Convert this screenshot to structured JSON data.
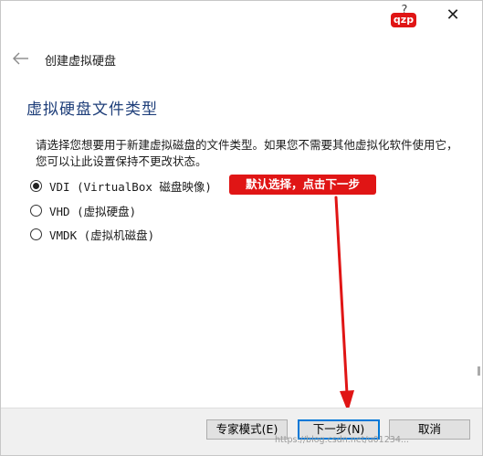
{
  "window": {
    "help_glyph": "?",
    "close_glyph": "✕",
    "stamp_text": "qzp"
  },
  "header": {
    "back_arrow": "←",
    "title": "创建虚拟硬盘"
  },
  "page": {
    "section_title": "虚拟硬盘文件类型",
    "description": "请选择您想要用于新建虚拟磁盘的文件类型。如果您不需要其他虚拟化软件使用它，您可以让此设置保持不更改状态。",
    "options": [
      {
        "label": "VDI (VirtualBox 磁盘映像)",
        "checked": true
      },
      {
        "label": "VHD (虚拟硬盘)",
        "checked": false
      },
      {
        "label": "VMDK (虚拟机磁盘)",
        "checked": false
      }
    ]
  },
  "annotation": {
    "note": "默认选择，点击下一步",
    "color": "#e01515"
  },
  "footer": {
    "expert_label": "专家模式(E)",
    "next_label": "下一步(N)",
    "cancel_label": "取消"
  },
  "watermark": "https://blog.csdn.net/u01234..."
}
